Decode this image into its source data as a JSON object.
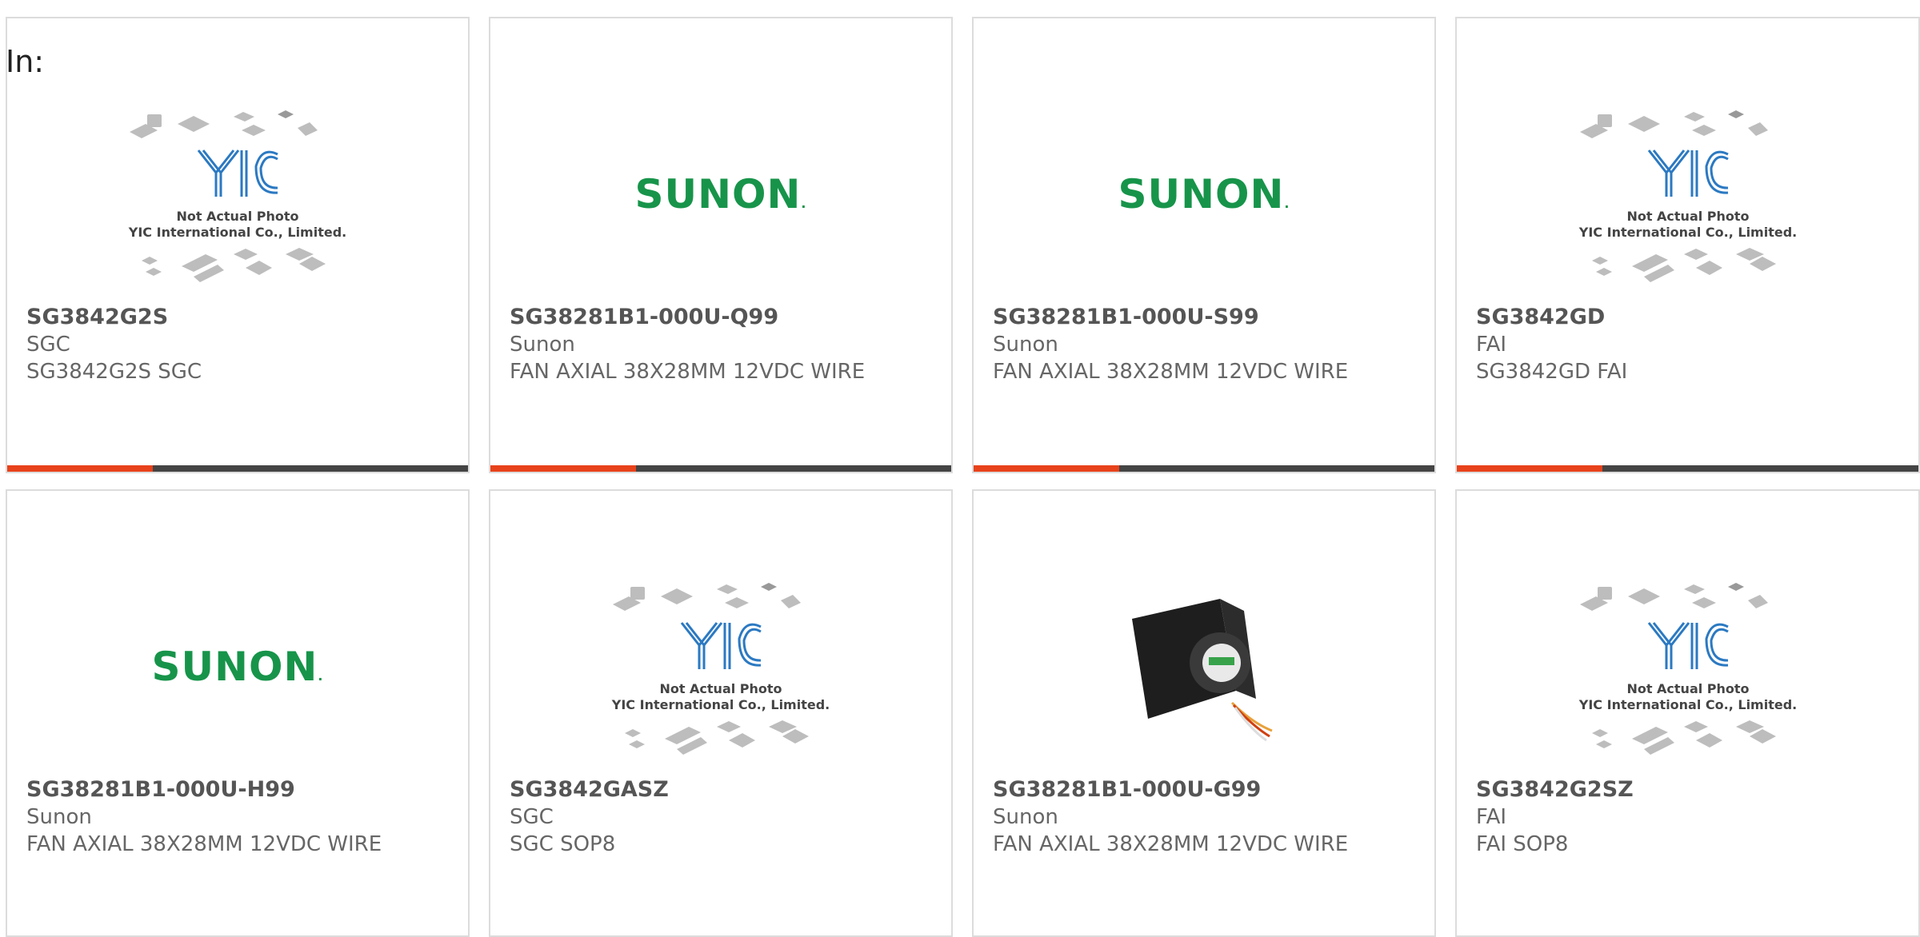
{
  "header": {
    "label": "In:"
  },
  "placeholder_caption": {
    "line1": "Not Actual Photo",
    "line2": "YIC International Co., Limited."
  },
  "sunon_logo": {
    "text": "SUNON",
    "mark": "."
  },
  "colors": {
    "accent": "#e8421b",
    "bar": "#444444",
    "sunon_green": "#17944a",
    "yic_blue": "#2b79c2"
  },
  "products": [
    {
      "part": "SG3842G2S",
      "manufacturer": "SGC",
      "description": "SG3842G2S SGC",
      "image": "yic-placeholder"
    },
    {
      "part": "SG38281B1-000U-Q99",
      "manufacturer": "Sunon",
      "description": "FAN AXIAL 38X28MM 12VDC WIRE",
      "image": "sunon-logo"
    },
    {
      "part": "SG38281B1-000U-S99",
      "manufacturer": "Sunon",
      "description": "FAN AXIAL 38X28MM 12VDC WIRE",
      "image": "sunon-logo"
    },
    {
      "part": "SG3842GD",
      "manufacturer": "FAI",
      "description": "SG3842GD FAI",
      "image": "yic-placeholder"
    },
    {
      "part": "SG38281B1-000U-H99",
      "manufacturer": "Sunon",
      "description": "FAN AXIAL 38X28MM 12VDC WIRE",
      "image": "sunon-logo"
    },
    {
      "part": "SG3842GASZ",
      "manufacturer": "SGC",
      "description": "SGC SOP8",
      "image": "yic-placeholder"
    },
    {
      "part": "SG38281B1-000U-G99",
      "manufacturer": "Sunon",
      "description": "FAN AXIAL 38X28MM 12VDC WIRE",
      "image": "fan-photo"
    },
    {
      "part": "SG3842G2SZ",
      "manufacturer": "FAI",
      "description": "FAI SOP8",
      "image": "yic-placeholder"
    }
  ]
}
